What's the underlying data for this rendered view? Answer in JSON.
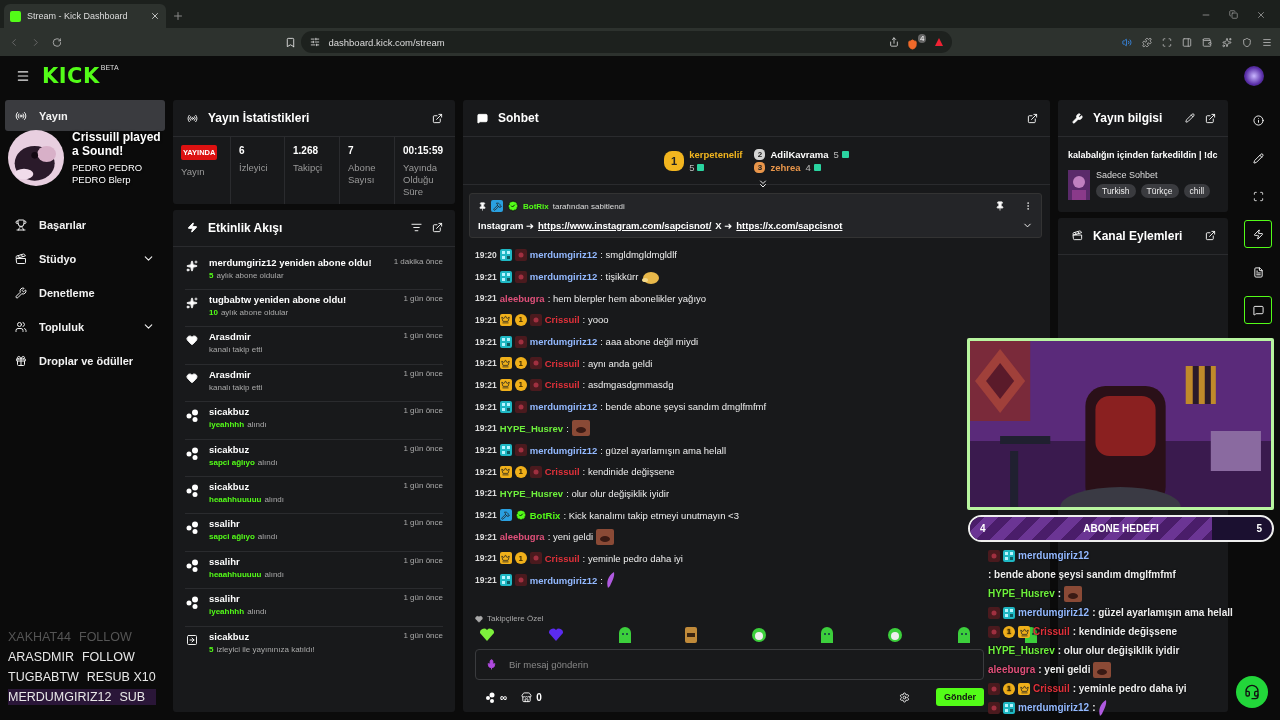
{
  "browser": {
    "tab_title": "Stream - Kick Dashboard",
    "url": "dashboard.kick.com/stream",
    "shield_count": "4"
  },
  "header": {
    "logo": "KICK",
    "logo_tag": "BETA"
  },
  "sidebar": {
    "items": [
      {
        "label": "Yayın",
        "selected": true,
        "collapsible": false
      },
      {
        "label": "Başarılar",
        "selected": false,
        "collapsible": false
      },
      {
        "label": "Stüdyo",
        "selected": false,
        "collapsible": true
      },
      {
        "label": "Denetleme",
        "selected": false,
        "collapsible": false
      },
      {
        "label": "Topluluk",
        "selected": false,
        "collapsible": true
      },
      {
        "label": "Droplar ve ödüller",
        "selected": false,
        "collapsible": false
      }
    ]
  },
  "stats": {
    "title": "Yayın İstatistikleri",
    "items": [
      {
        "kind": "badge",
        "value": "YAYINDA",
        "label": "Yayın"
      },
      {
        "kind": "number",
        "value": "6",
        "label": "İzleyici"
      },
      {
        "kind": "number",
        "value": "1.268",
        "label": "Takipçi"
      },
      {
        "kind": "number",
        "value": "7",
        "label": "Abone Sayısı"
      },
      {
        "kind": "number",
        "value": "00:15:59",
        "label": "Yayında Olduğu Süre"
      }
    ]
  },
  "activity": {
    "title": "Etkinlik Akışı",
    "items": [
      {
        "kind": "sub",
        "title": "merdumgiriz12 yeniden abone oldu!",
        "highlight": "5",
        "detail": "aylık abone oldular",
        "time": "1 dakika önce"
      },
      {
        "kind": "sub",
        "title": "tugbabtw yeniden abone oldu!",
        "highlight": "10",
        "detail": "aylık abone oldular",
        "time": "1 gün önce"
      },
      {
        "kind": "follow",
        "title": "Arasdmir",
        "detail": "kanalı takip etti",
        "time": "1 gün önce"
      },
      {
        "kind": "follow",
        "title": "Arasdmir",
        "detail": "kanalı takip etti",
        "time": "1 gün önce"
      },
      {
        "kind": "reward",
        "title": "sicakbuz",
        "highlight": "iyeahhhh",
        "detail": "alındı",
        "time": "1 gün önce"
      },
      {
        "kind": "reward",
        "title": "sicakbuz",
        "highlight": "sapci ağlıyo",
        "detail": "alındı",
        "time": "1 gün önce"
      },
      {
        "kind": "reward",
        "title": "sicakbuz",
        "highlight": "heaahhuuuuu",
        "detail": "alındı",
        "time": "1 gün önce"
      },
      {
        "kind": "reward",
        "title": "ssalihr",
        "highlight": "sapci ağlıyo",
        "detail": "alındı",
        "time": "1 gün önce"
      },
      {
        "kind": "reward",
        "title": "ssalihr",
        "highlight": "heaahhuuuuu",
        "detail": "alındı",
        "time": "1 gün önce"
      },
      {
        "kind": "reward",
        "title": "ssalihr",
        "highlight": "iyeahhhh",
        "detail": "alındı",
        "time": "1 gün önce"
      },
      {
        "kind": "host",
        "title": "sicakbuz",
        "highlight": "5",
        "detail": "izleyici ile yayınınıza katıldı!",
        "time": "1 gün önce"
      }
    ]
  },
  "chat": {
    "title": "Sohbet",
    "gifters": [
      {
        "rank": "1",
        "user": "kerpetenelif",
        "count": "5",
        "color": "#f2b51f"
      },
      {
        "rank": "2",
        "user": "AdilKavrama",
        "count": "5",
        "color": "#d4d4d4"
      },
      {
        "rank": "3",
        "user": "zehrea",
        "count": "4",
        "color": "#e8954a"
      }
    ],
    "pinned": {
      "user": "BotRix",
      "by_text": "tarafından sabitlendi",
      "parts": [
        {
          "kind": "text",
          "text": "Instagram ➜"
        },
        {
          "kind": "link",
          "text": "https://www.instagram.com/sapcisnot/"
        },
        {
          "kind": "text",
          "text": "X ➜"
        },
        {
          "kind": "link",
          "text": "https://x.com/sapcisnot"
        }
      ]
    },
    "messages": [
      {
        "time": "19:20",
        "badges": [
          {
            "kind": "og"
          },
          {
            "kind": "sub"
          }
        ],
        "user": "merdumgiriz12",
        "color": "#93b9ff",
        "text": ": smgldmgldmgldlf"
      },
      {
        "time": "19:21",
        "badges": [
          {
            "kind": "og"
          },
          {
            "kind": "sub"
          }
        ],
        "user": "merdumgiriz12",
        "color": "#93b9ff",
        "text": ": tişikkürr",
        "emote": {
          "kind": "hamster"
        }
      },
      {
        "time": "19:21",
        "user": "aleebugra",
        "color": "#e0507a",
        "text": ": hem blerpler hem abonelikler yağıyo"
      },
      {
        "time": "19:21",
        "badges": [
          {
            "kind": "crown"
          },
          {
            "kind": "rank",
            "label": "1"
          },
          {
            "kind": "sub"
          }
        ],
        "user": "Crissuil",
        "color": "#e0313a",
        "text": ": yooo"
      },
      {
        "time": "19:21",
        "badges": [
          {
            "kind": "og"
          },
          {
            "kind": "sub"
          }
        ],
        "user": "merdumgiriz12",
        "color": "#93b9ff",
        "text": ": aaa abone değil miydi"
      },
      {
        "time": "19:21",
        "badges": [
          {
            "kind": "crown"
          },
          {
            "kind": "rank",
            "label": "1"
          },
          {
            "kind": "sub"
          }
        ],
        "user": "Crissuil",
        "color": "#e0313a",
        "text": ": aynı anda geldi"
      },
      {
        "time": "19:21",
        "badges": [
          {
            "kind": "crown"
          },
          {
            "kind": "rank",
            "label": "1"
          },
          {
            "kind": "sub"
          }
        ],
        "user": "Crissuil",
        "color": "#e0313a",
        "text": ": asdmgasdgmmasdg"
      },
      {
        "time": "19:21",
        "badges": [
          {
            "kind": "og"
          },
          {
            "kind": "sub"
          }
        ],
        "user": "merdumgiriz12",
        "color": "#93b9ff",
        "text": ": bende abone şeysi sandım dmglfmfmf"
      },
      {
        "time": "19:21",
        "user": "HYPE_Husrev",
        "color": "#6ef03c",
        "text": ":",
        "emote": {
          "kind": "face"
        }
      },
      {
        "time": "19:21",
        "badges": [
          {
            "kind": "og"
          },
          {
            "kind": "sub"
          }
        ],
        "user": "merdumgiriz12",
        "color": "#93b9ff",
        "text": ": güzel ayarlamışın ama helall"
      },
      {
        "time": "19:21",
        "badges": [
          {
            "kind": "crown"
          },
          {
            "kind": "rank",
            "label": "1"
          },
          {
            "kind": "sub"
          }
        ],
        "user": "Crissuil",
        "color": "#e0313a",
        "text": ": kendinide değişsene"
      },
      {
        "time": "19:21",
        "user": "HYPE_Husrev",
        "color": "#6ef03c",
        "text": ": olur olur değişiklik iyidir"
      },
      {
        "time": "19:21",
        "badges": [
          {
            "kind": "bot"
          },
          {
            "kind": "verified"
          }
        ],
        "user": "BotRix",
        "color": "#53fc18",
        "text": ": Kick kanalımı takip etmeyi unutmayın <3"
      },
      {
        "time": "19:21",
        "user": "aleebugra",
        "color": "#e0507a",
        "text": ": yeni geldi",
        "emote": {
          "kind": "face"
        }
      },
      {
        "time": "19:21",
        "badges": [
          {
            "kind": "crown"
          },
          {
            "kind": "rank",
            "label": "1"
          },
          {
            "kind": "sub"
          }
        ],
        "user": "Crissuil",
        "color": "#e0313a",
        "text": ": yeminle pedro daha iyi"
      },
      {
        "time": "19:21",
        "badges": [
          {
            "kind": "og"
          },
          {
            "kind": "sub"
          }
        ],
        "user": "merdumgiriz12",
        "color": "#93b9ff",
        "text": ":",
        "emote": {
          "kind": "feather"
        }
      }
    ],
    "emote_row": {
      "title": "Takipçilere Özel",
      "emotes": [
        {
          "kind": "heart",
          "color": "#7df03c"
        },
        {
          "kind": "heart",
          "color": "#5b2bf0"
        },
        {
          "kind": "blob",
          "color": "#3ccf3c"
        },
        {
          "kind": "box",
          "color": "#c08a3a"
        },
        {
          "kind": "round",
          "color": "#3ccf3c"
        },
        {
          "kind": "blob",
          "color": "#3ccf3c"
        },
        {
          "kind": "round",
          "color": "#3ccf3c"
        },
        {
          "kind": "blob",
          "color": "#3ccf3c"
        },
        {
          "kind": "blob",
          "color": "#3ccf3c"
        }
      ]
    },
    "input": {
      "placeholder": "Bir mesaj gönderin"
    },
    "points": "∞",
    "store_count": "0",
    "send_label": "Gönder"
  },
  "stream_info": {
    "title": "Yayın bilgisi",
    "stream_title": "kalabalığın içinden farkedildin | !dc",
    "category": "Sadece Sohbet",
    "tags": [
      "Turkish",
      "Türkçe",
      "chill"
    ]
  },
  "channel_actions": {
    "title": "Kanal Eylemleri"
  },
  "toolbar": [
    {
      "selected": false
    },
    {
      "selected": false
    },
    {
      "selected": false
    },
    {
      "selected": true
    },
    {
      "selected": false
    },
    {
      "selected": true
    }
  ],
  "overlay": {
    "alert": {
      "title": "Crissuill played a Sound!",
      "subtitle": "PEDRO PEDRO PEDRO Blerp"
    },
    "events": [
      {
        "user": "XAKHAT44",
        "action": "FOLLOW",
        "faded": true,
        "highlighted": false
      },
      {
        "user": "ARASDMIR",
        "action": "FOLLOW",
        "faded": false,
        "highlighted": false
      },
      {
        "user": "TUGBABTW",
        "action": "RESUB X10",
        "faded": false,
        "highlighted": false
      },
      {
        "user": "MERDUMGIRIZ12",
        "action": "SUB",
        "faded": false,
        "highlighted": true
      }
    ],
    "goal": {
      "title": "ABONE HEDEFI",
      "current": "4",
      "target": "5",
      "level": 0.8
    },
    "chat": [
      {
        "badges": [
          {
            "kind": "sub"
          },
          {
            "kind": "og"
          }
        ],
        "user": "merdumgiriz12",
        "color": "#93b9ff",
        "text": ": bende abone şeysi sandım dmglfmfmf"
      },
      {
        "user": "HYPE_Husrev",
        "color": "#6ef03c",
        "text": ":",
        "emote": {
          "kind": "face"
        }
      },
      {
        "badges": [
          {
            "kind": "sub"
          },
          {
            "kind": "og"
          }
        ],
        "user": "merdumgiriz12",
        "color": "#93b9ff",
        "text": ": güzel ayarlamışın ama helall"
      },
      {
        "badges": [
          {
            "kind": "sub"
          },
          {
            "kind": "rank",
            "label": "1"
          },
          {
            "kind": "crown"
          }
        ],
        "user": "Crissuil",
        "color": "#e0313a",
        "text": ": kendinide değişsene"
      },
      {
        "user": "HYPE_Husrev",
        "color": "#6ef03c",
        "text": ": olur olur değişiklik iyidir"
      },
      {
        "user": "aleebugra",
        "color": "#e0507a",
        "text": ": yeni geldi",
        "emote": {
          "kind": "face"
        }
      },
      {
        "badges": [
          {
            "kind": "sub"
          },
          {
            "kind": "rank",
            "label": "1"
          },
          {
            "kind": "crown"
          }
        ],
        "user": "Crissuil",
        "color": "#e0313a",
        "text": ": yeminle pedro daha iyi"
      },
      {
        "badges": [
          {
            "kind": "sub"
          },
          {
            "kind": "og"
          }
        ],
        "user": "merdumgiriz12",
        "color": "#93b9ff",
        "text": ":",
        "emote": {
          "kind": "feather"
        }
      }
    ]
  }
}
